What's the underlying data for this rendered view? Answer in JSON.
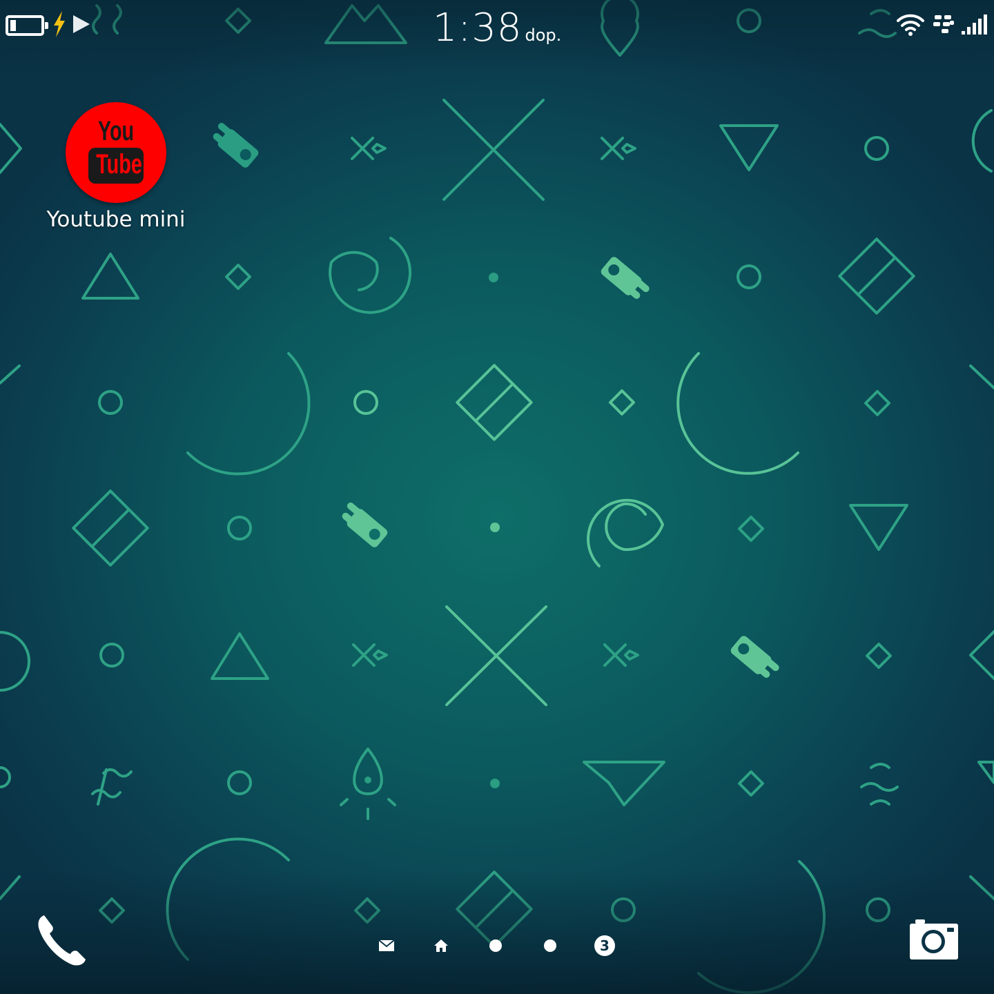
{
  "status_bar": {
    "time": "1:38",
    "ampm": "dop.",
    "icons": [
      "battery-icon",
      "charging-bolt-icon",
      "media-playing-icon",
      "wifi-icon",
      "blackberry-logo-icon",
      "cell-signal-icon"
    ]
  },
  "home": {
    "apps": [
      {
        "label": "Youtube mini",
        "icon_text_top": "You",
        "icon_text_bottom": "Tube"
      }
    ]
  },
  "navigation": {
    "left_action": "phone-icon",
    "right_action": "camera-icon",
    "pages": [
      "hub-envelope-icon",
      "home-icon",
      "page-dot",
      "page-dot",
      "page-badge"
    ],
    "badge_text": "3"
  },
  "colors": {
    "wallpaper_center": "#0e6e68",
    "wallpaper_edge": "#0a3346",
    "pattern": "#2ea286",
    "pattern_highlight": "#5fc596",
    "youtube_red": "#ff0000"
  }
}
